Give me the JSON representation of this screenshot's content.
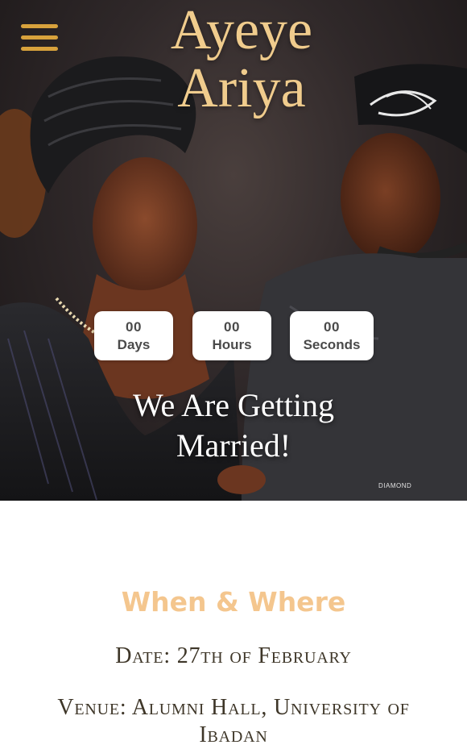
{
  "header": {
    "menu_icon": "hamburger-menu-icon",
    "menu_color": "#d8a23c",
    "title_line1": "Ayeye",
    "title_line2": "Ariya",
    "title_color": "#f0cc8d"
  },
  "countdown": {
    "days": {
      "value": "00",
      "label": "Days"
    },
    "hours": {
      "value": "00",
      "label": "Hours"
    },
    "seconds": {
      "value": "00",
      "label": "Seconds"
    }
  },
  "hero": {
    "tagline_line1": "We Are Getting",
    "tagline_line2": "Married!",
    "watermark": "DIAMOND"
  },
  "details": {
    "heading": "When & Where",
    "heading_color": "#f4c68e",
    "date": "Date: 27th of February",
    "venue": "Venue: Alumni Hall, University of Ibadan"
  }
}
